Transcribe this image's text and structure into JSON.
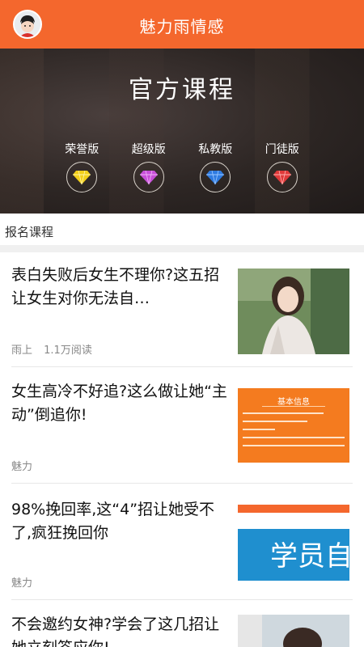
{
  "app_bar": {
    "title": "魅力雨情感",
    "avatar_icon": "cartoon-avatar-icon",
    "color": "#f4672d"
  },
  "banner": {
    "title": "官方课程",
    "tiers": [
      {
        "label": "荣誉版",
        "icon": "diamond-icon",
        "color": "#f2cf1a"
      },
      {
        "label": "超级版",
        "icon": "diamond-icon",
        "color": "#c84fd8"
      },
      {
        "label": "私教版",
        "icon": "diamond-icon",
        "color": "#2f7be0"
      },
      {
        "label": "门徒版",
        "icon": "diamond-icon",
        "color": "#e03a3a"
      }
    ]
  },
  "section": {
    "label": "报名课程"
  },
  "articles": [
    {
      "title": "表白失败后女生不理你?这五招让女生对你无法自…",
      "author": "雨上",
      "reads": "1.1万阅读",
      "thumb_text": ""
    },
    {
      "title": "女生高冷不好追?这么做让她“主动”倒追你!",
      "author": "魅力",
      "reads": "",
      "thumb_text": "基本信息"
    },
    {
      "title": "98%挽回率,这“4”招让她受不了,疯狂挽回你",
      "author": "魅力",
      "reads": "",
      "thumb_text": "学员自"
    },
    {
      "title": "不会邀约女神?学会了这几招让她立刻答应你!",
      "author": "",
      "reads": "",
      "thumb_text": ""
    }
  ]
}
